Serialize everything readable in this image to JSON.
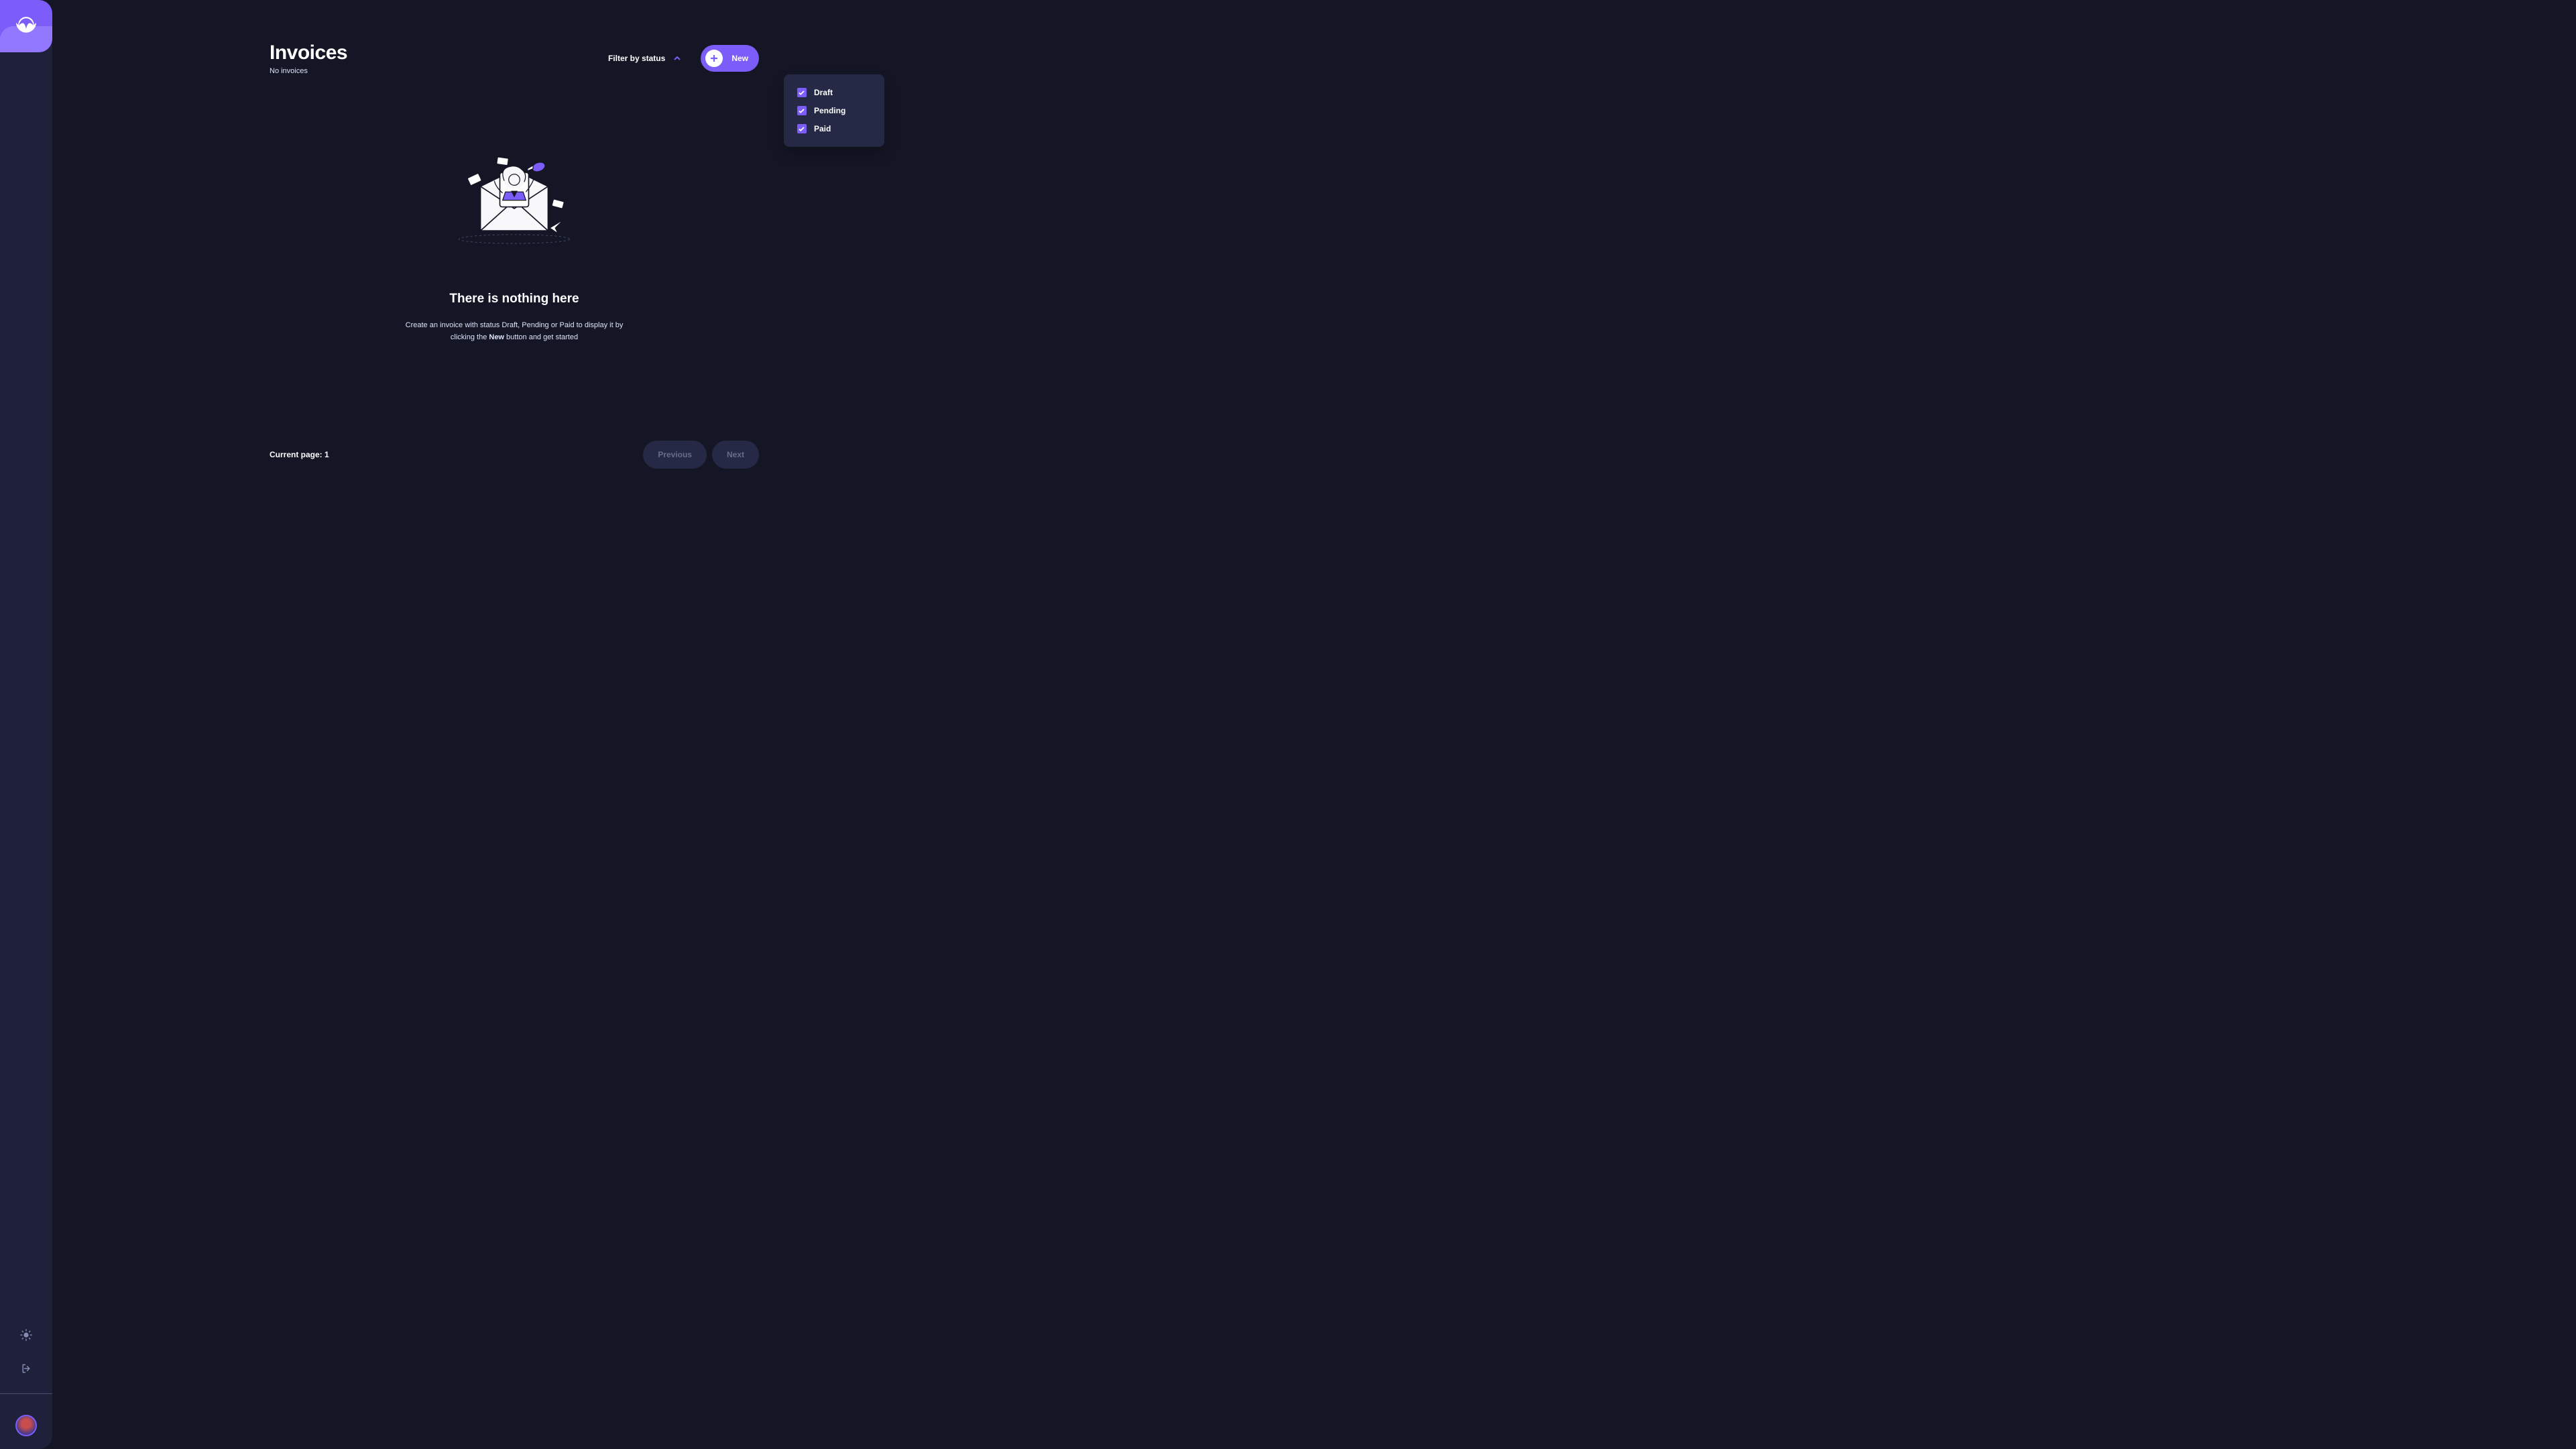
{
  "sidebar": {
    "theme_icon_name": "sun-icon",
    "logout_icon_name": "logout-icon"
  },
  "header": {
    "title": "Invoices",
    "subtitle": "No invoices",
    "filter_label": "Filter by status",
    "new_button_label": "New"
  },
  "filter_options": [
    {
      "label": "Draft",
      "checked": true
    },
    {
      "label": "Pending",
      "checked": true
    },
    {
      "label": "Paid",
      "checked": true
    }
  ],
  "empty_state": {
    "title": "There is nothing here",
    "text_before": "Create an invoice with status Draft, Pending or Paid to display it by clicking the ",
    "text_bold": "New",
    "text_after": " button and get started"
  },
  "pagination": {
    "current_label": "Current page: 1",
    "previous_label": "Previous",
    "next_label": "Next"
  },
  "colors": {
    "accent": "#7c5dfa",
    "bg": "#141625",
    "panel": "#1e2139",
    "dropdown": "#252945"
  }
}
